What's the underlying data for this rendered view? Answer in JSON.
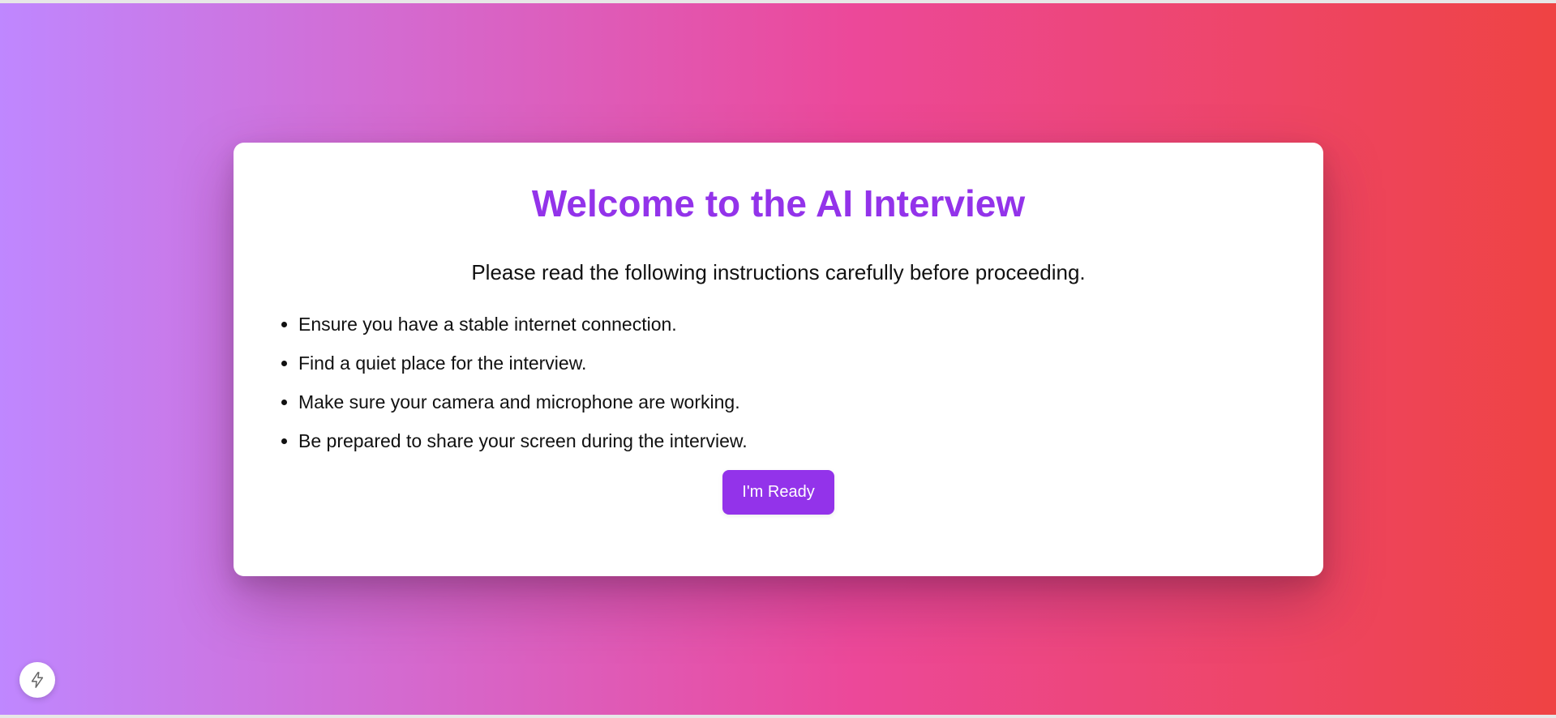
{
  "welcome": {
    "title": "Welcome to the AI Interview",
    "subtitle": "Please read the following instructions carefully before proceeding.",
    "instructions": [
      "Ensure you have a stable internet connection.",
      "Find a quiet place for the interview.",
      "Make sure your camera and microphone are working.",
      "Be prepared to share your screen during the interview."
    ],
    "ready_label": "I'm Ready"
  },
  "floating_action": {
    "icon": "lightning-icon"
  },
  "colors": {
    "accent": "#9333ea",
    "gradient_start": "#bf87ff",
    "gradient_mid": "#ec4899",
    "gradient_end": "#ef4343"
  }
}
